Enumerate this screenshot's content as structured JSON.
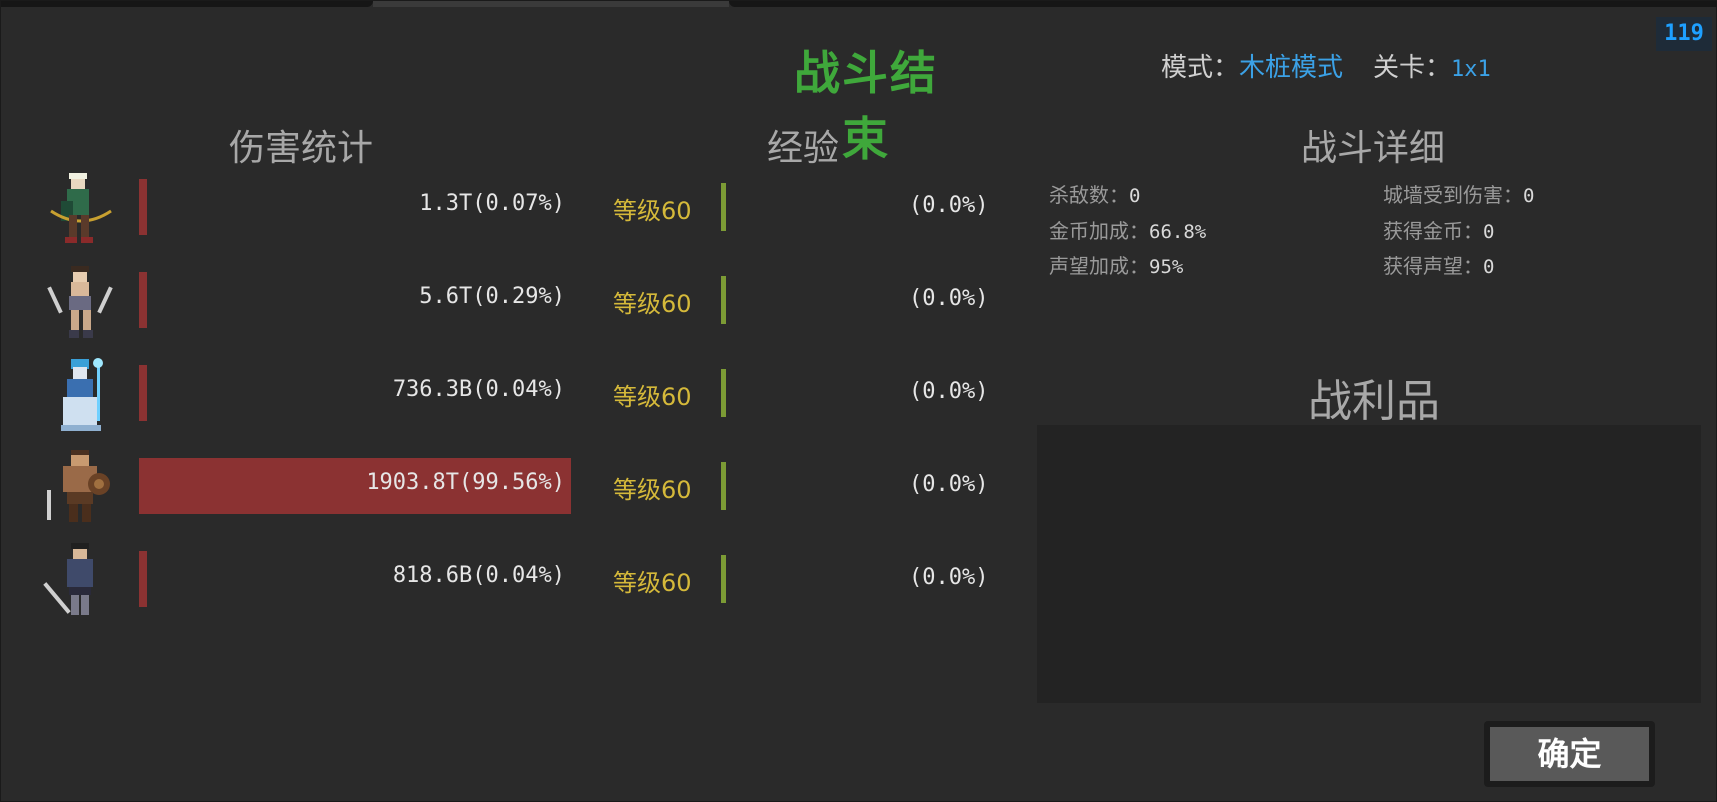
{
  "fps": "119",
  "title": "战斗结束",
  "mode": {
    "mode_label": "模式：",
    "mode_value": "木桩模式",
    "stage_label": "关卡：",
    "stage_value": "1x1"
  },
  "headers": {
    "damage": "伤害统计",
    "exp": "经验",
    "detail": "战斗详细",
    "loot": "战利品"
  },
  "heroes": [
    {
      "name": "archer",
      "damage": "1.3T(0.07%)",
      "damage_pct": 0.07,
      "level": "等级60",
      "exp": "(0.0%)",
      "exp_pct": 0.0
    },
    {
      "name": "dual-blade",
      "damage": "5.6T(0.29%)",
      "damage_pct": 0.29,
      "level": "等级60",
      "exp": "(0.0%)",
      "exp_pct": 0.0
    },
    {
      "name": "ice-mage",
      "damage": "736.3B(0.04%)",
      "damage_pct": 0.04,
      "level": "等级60",
      "exp": "(0.0%)",
      "exp_pct": 0.0
    },
    {
      "name": "barbarian",
      "damage": "1903.8T(99.56%)",
      "damage_pct": 99.56,
      "level": "等级60",
      "exp": "(0.0%)",
      "exp_pct": 0.0
    },
    {
      "name": "swordsman",
      "damage": "818.6B(0.04%)",
      "damage_pct": 0.04,
      "level": "等级60",
      "exp": "(0.0%)",
      "exp_pct": 0.0
    }
  ],
  "detail": {
    "kills_label": "杀敌数：",
    "kills": "0",
    "gold_bonus_label": "金币加成：",
    "gold_bonus": "66.8%",
    "rep_bonus_label": "声望加成：",
    "rep_bonus": "95%",
    "wall_damage_label": "城墙受到伤害：",
    "wall_damage": "0",
    "gold_gain_label": "获得金币：",
    "gold_gain": "0",
    "rep_gain_label": "获得声望：",
    "rep_gain": "0"
  },
  "ok_button": "确定",
  "colors": {
    "title": "#3fa83b",
    "damage_bar": "#8b3232",
    "exp_bar": "#7c9b35",
    "level": "#d5b93a",
    "accent": "#3ba1e6"
  }
}
